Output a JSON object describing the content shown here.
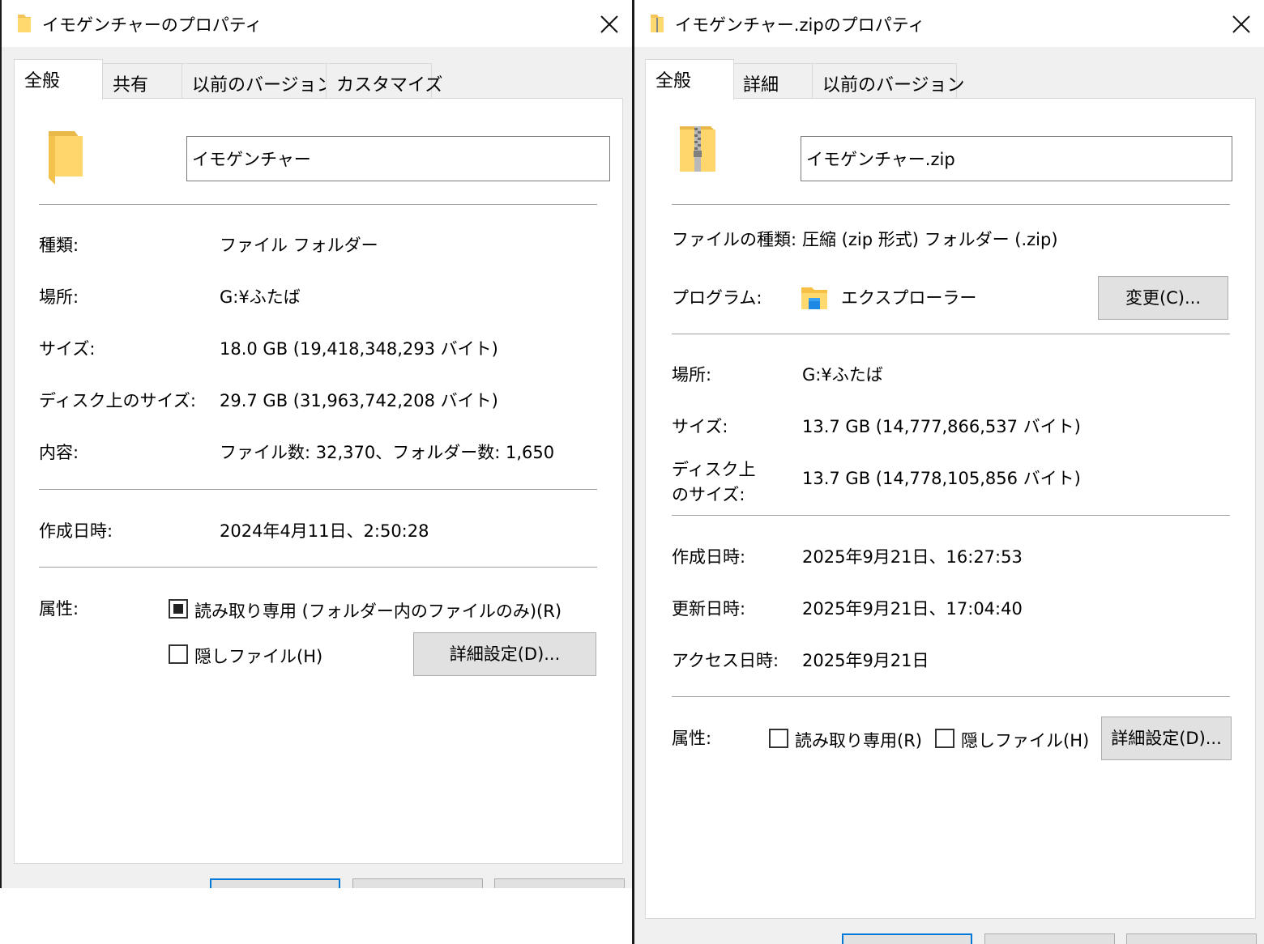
{
  "folder_dialog": {
    "title": "イモゲンチャーのプロパティ",
    "tabs": [
      "全般",
      "共有",
      "以前のバージョン",
      "カスタマイズ"
    ],
    "name_value": "イモゲンチャー",
    "rows": [
      {
        "label": "種類:",
        "value": "ファイル フォルダー"
      },
      {
        "label": "場所:",
        "value": "G:¥ふたば"
      },
      {
        "label": "サイズ:",
        "value": "18.0 GB (19,418,348,293 バイト)"
      },
      {
        "label": "ディスク上のサイズ:",
        "value": "29.7 GB (31,963,742,208 バイト)"
      },
      {
        "label": "内容:",
        "value": "ファイル数: 32,370、フォルダー数: 1,650"
      }
    ],
    "created_label": "作成日時:",
    "created_value": "2024年4月11日、2:50:28",
    "attributes_label": "属性:",
    "readonly_label": "読み取り専用 (フォルダー内のファイルのみ)(R)",
    "hidden_label": "隠しファイル(H)",
    "advanced_button": "詳細設定(D)..."
  },
  "zip_dialog": {
    "title": "イモゲンチャー.zipのプロパティ",
    "tabs": [
      "全般",
      "詳細",
      "以前のバージョン"
    ],
    "name_value": "イモゲンチャー.zip",
    "type_label": "ファイルの種類:",
    "type_value": "圧縮 (zip 形式) フォルダー (.zip)",
    "program_label": "プログラム:",
    "program_value": "エクスプローラー",
    "change_button": "変更(C)...",
    "location_label": "場所:",
    "location_value": "G:¥ふたば",
    "size_label": "サイズ:",
    "size_value": "13.7 GB (14,777,866,537 バイト)",
    "disk_size_label_1": "ディスク上",
    "disk_size_label_2": "のサイズ:",
    "disk_size_value": "13.7 GB (14,778,105,856 バイト)",
    "created_label": "作成日時:",
    "created_value": "2025年9月21日、16:27:53",
    "modified_label": "更新日時:",
    "modified_value": "2025年9月21日、17:04:40",
    "accessed_label": "アクセス日時:",
    "accessed_value": "2025年9月21日",
    "attributes_label": "属性:",
    "readonly_label": "読み取り専用(R)",
    "hidden_label": "隠しファイル(H)",
    "advanced_button": "詳細設定(D)..."
  }
}
